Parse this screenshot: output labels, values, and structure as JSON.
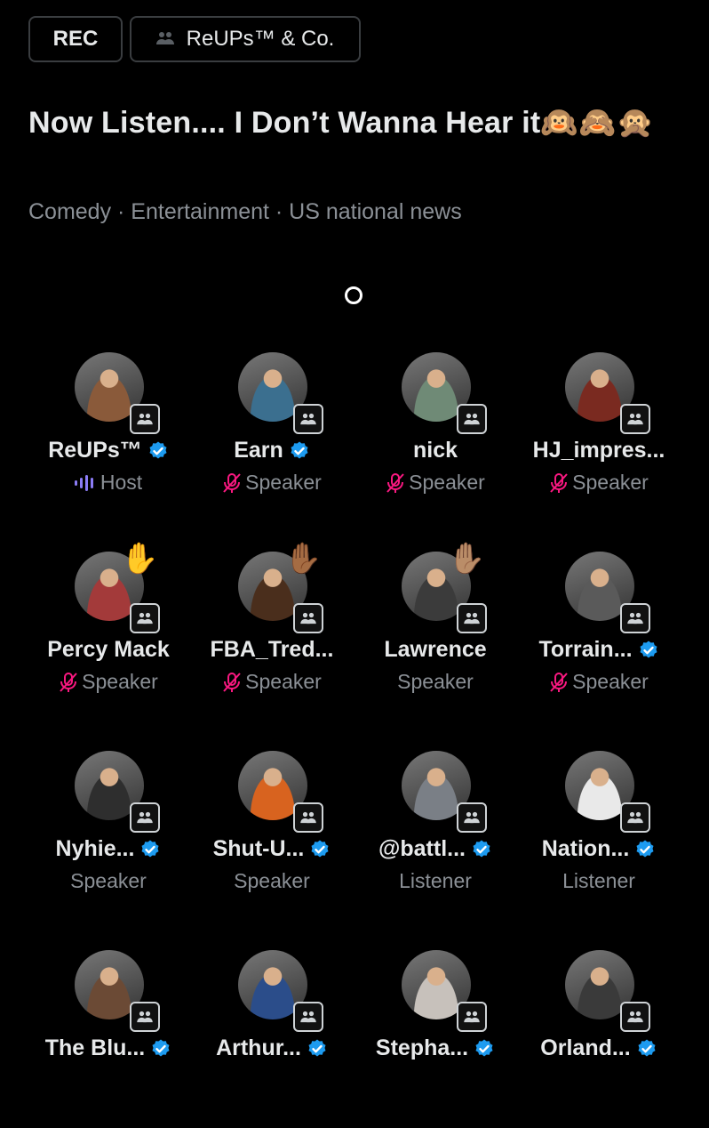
{
  "header": {
    "rec_label": "REC",
    "community_label": "ReUPs™ & Co."
  },
  "space": {
    "title": "Now Listen.... I Don’t Wanna Hear it🙉🙈🙊",
    "tags": "Comedy · Entertainment · US national news"
  },
  "colors": {
    "background": "#000000",
    "text": "#e7e9ea",
    "muted": "#8b9096",
    "verified": "#1d9bf0",
    "muted_mic": "#f91880",
    "host_bars": "#8b7cf6"
  },
  "participants": [
    {
      "name": "ReUPs™",
      "role": "Host",
      "verified": true,
      "muted": false,
      "host": true,
      "hand": "",
      "avatar_color": "#8a5a3a"
    },
    {
      "name": "Earn",
      "role": "Speaker",
      "verified": true,
      "muted": true,
      "host": false,
      "hand": "",
      "avatar_color": "#3b6f8f"
    },
    {
      "name": "nick",
      "role": "Speaker",
      "verified": false,
      "muted": true,
      "host": false,
      "hand": "",
      "avatar_color": "#6f8a76"
    },
    {
      "name": "HJ_impres...",
      "role": "Speaker",
      "verified": false,
      "muted": true,
      "host": false,
      "hand": "",
      "avatar_color": "#7a2a20"
    },
    {
      "name": "Percy Mack",
      "role": "Speaker",
      "verified": false,
      "muted": true,
      "host": false,
      "hand": "✋",
      "avatar_color": "#a33a3a"
    },
    {
      "name": "FBA_Tred...",
      "role": "Speaker",
      "verified": false,
      "muted": true,
      "host": false,
      "hand": "✋🏾",
      "avatar_color": "#4a2e1c"
    },
    {
      "name": "Lawrence",
      "role": "Speaker",
      "verified": false,
      "muted": false,
      "host": false,
      "hand": "✋🏽",
      "avatar_color": "#3b3b3b"
    },
    {
      "name": "Torrain...",
      "role": "Speaker",
      "verified": true,
      "muted": true,
      "host": false,
      "hand": "",
      "avatar_color": "#5a5a5a"
    },
    {
      "name": "Nyhie...",
      "role": "Speaker",
      "verified": true,
      "muted": false,
      "host": false,
      "hand": "",
      "avatar_color": "#2e2e2e"
    },
    {
      "name": "Shut-U...",
      "role": "Speaker",
      "verified": true,
      "muted": false,
      "host": false,
      "hand": "",
      "avatar_color": "#d8631f"
    },
    {
      "name": "@battl...",
      "role": "Listener",
      "verified": true,
      "muted": false,
      "host": false,
      "hand": "",
      "avatar_color": "#7a7f86"
    },
    {
      "name": "Nation...",
      "role": "Listener",
      "verified": true,
      "muted": false,
      "host": false,
      "hand": "",
      "avatar_color": "#e9e9e9"
    },
    {
      "name": "The Blu...",
      "role": "",
      "verified": true,
      "muted": false,
      "host": false,
      "hand": "",
      "avatar_color": "#6b4a35"
    },
    {
      "name": "Arthur...",
      "role": "",
      "verified": true,
      "muted": false,
      "host": false,
      "hand": "",
      "avatar_color": "#2b4d8a"
    },
    {
      "name": "Stepha...",
      "role": "",
      "verified": true,
      "muted": false,
      "host": false,
      "hand": "",
      "avatar_color": "#c7c1bb"
    },
    {
      "name": "Orland...",
      "role": "",
      "verified": true,
      "muted": false,
      "host": false,
      "hand": "",
      "avatar_color": "#3a3a3a"
    }
  ]
}
